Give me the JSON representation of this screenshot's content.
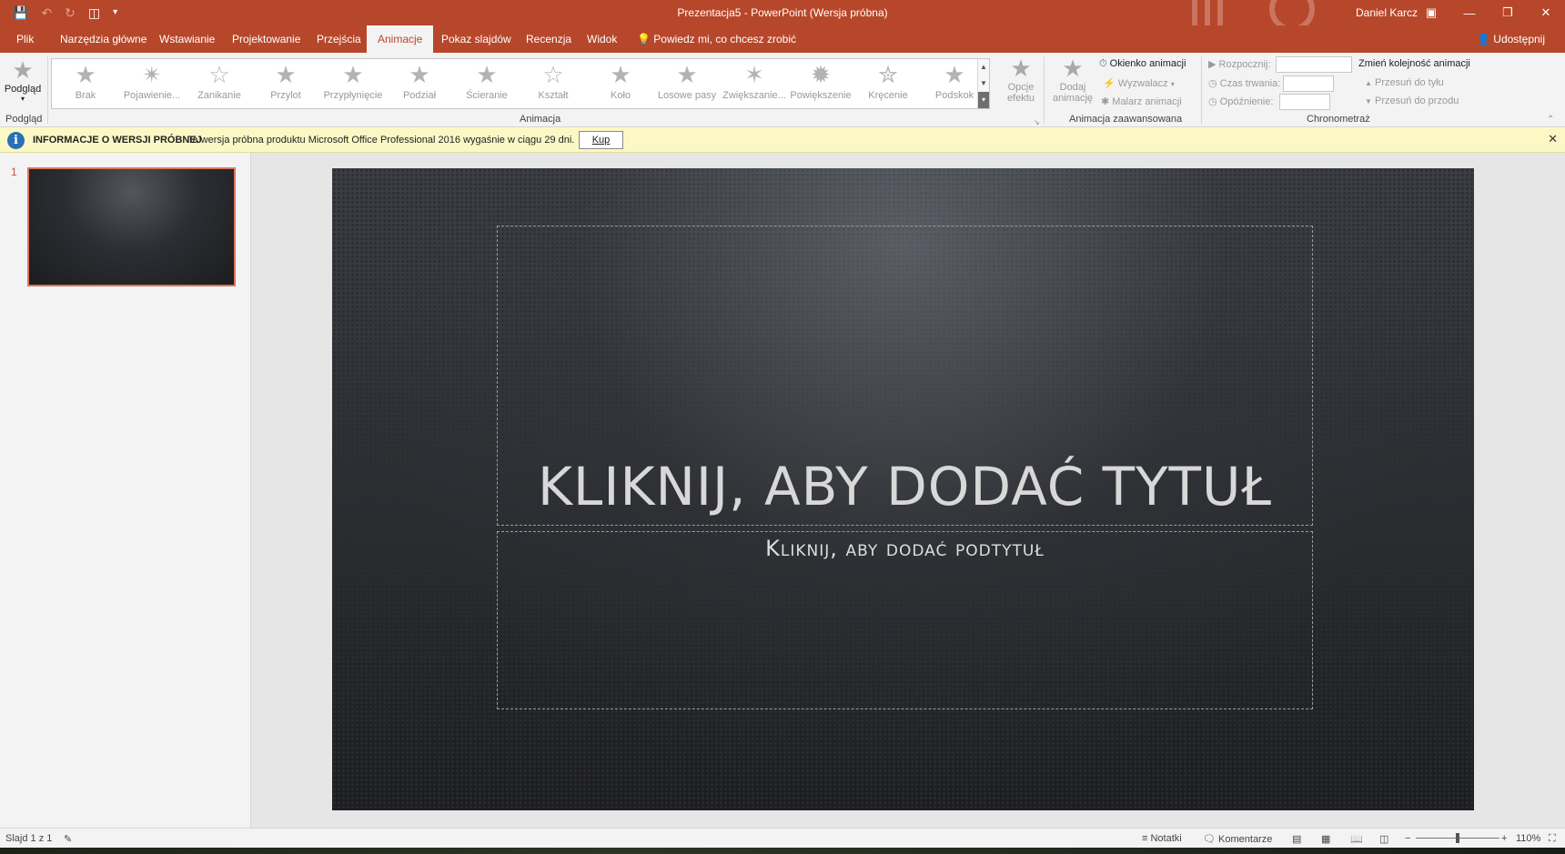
{
  "titlebar": {
    "title": "Prezentacja5  -  PowerPoint (Wersja próbna)",
    "user": "Daniel Karcz",
    "qat": {
      "save_icon": "save-icon",
      "undo_icon": "undo-icon",
      "redo_icon": "redo-icon",
      "start_icon": "start-from-beginning-icon",
      "customize_icon": "customize-qat-icon"
    }
  },
  "tabs": [
    {
      "label": "Plik"
    },
    {
      "label": "Narzędzia główne"
    },
    {
      "label": "Wstawianie"
    },
    {
      "label": "Projektowanie"
    },
    {
      "label": "Przejścia"
    },
    {
      "label": "Animacje"
    },
    {
      "label": "Pokaz slajdów"
    },
    {
      "label": "Recenzja"
    },
    {
      "label": "Widok"
    },
    {
      "label": "Powiedz mi, co chcesz zrobić"
    }
  ],
  "share_label": "Udostępnij",
  "ribbon": {
    "preview": {
      "label": "Podgląd",
      "group": "Podgląd"
    },
    "animations": [
      {
        "label": "Brak"
      },
      {
        "label": "Pojawienie..."
      },
      {
        "label": "Zanikanie"
      },
      {
        "label": "Przylot"
      },
      {
        "label": "Przypłynięcie"
      },
      {
        "label": "Podział"
      },
      {
        "label": "Ścieranie"
      },
      {
        "label": "Kształt"
      },
      {
        "label": "Koło"
      },
      {
        "label": "Losowe pasy"
      },
      {
        "label": "Zwiększanie..."
      },
      {
        "label": "Powiększenie"
      },
      {
        "label": "Kręcenie"
      },
      {
        "label": "Podskok"
      }
    ],
    "effect_options": {
      "line1": "Opcje",
      "line2": "efektu"
    },
    "animation_group": "Animacja",
    "add_animation": {
      "line1": "Dodaj",
      "line2": "animację"
    },
    "animation_pane": "Okienko animacji",
    "trigger": "Wyzwalacz",
    "animation_painter": "Malarz animacji",
    "advanced_group": "Animacja zaawansowana",
    "start_label": "Rozpocznij:",
    "duration_label": "Czas trwania:",
    "delay_label": "Opóźnienie:",
    "timing_group": "Chronometraż",
    "reorder_title": "Zmień kolejność animacji",
    "move_earlier": "Przesuń do tyłu",
    "move_later": "Przesuń do przodu"
  },
  "infobar": {
    "title": "INFORMACJE O WERSJI PRÓBNEJ",
    "message": "Ta wersja próbna produktu Microsoft Office Professional 2016 wygaśnie w ciągu 29 dni.",
    "buy_label": "Kup"
  },
  "slides": [
    {
      "number": "1"
    }
  ],
  "slide": {
    "title_placeholder": "KLIKNIJ, ABY DODAĆ TYTUŁ",
    "subtitle_placeholder": "Kliknij, aby dodać podtytuł"
  },
  "status": {
    "slide_count": "Slajd 1 z 1",
    "notes": "Notatki",
    "comments": "Komentarze",
    "zoom": "110%"
  },
  "colors": {
    "accent": "#b7472a",
    "info_bar": "#fcf8c6",
    "selected_thumb_border": "#e0735a"
  }
}
